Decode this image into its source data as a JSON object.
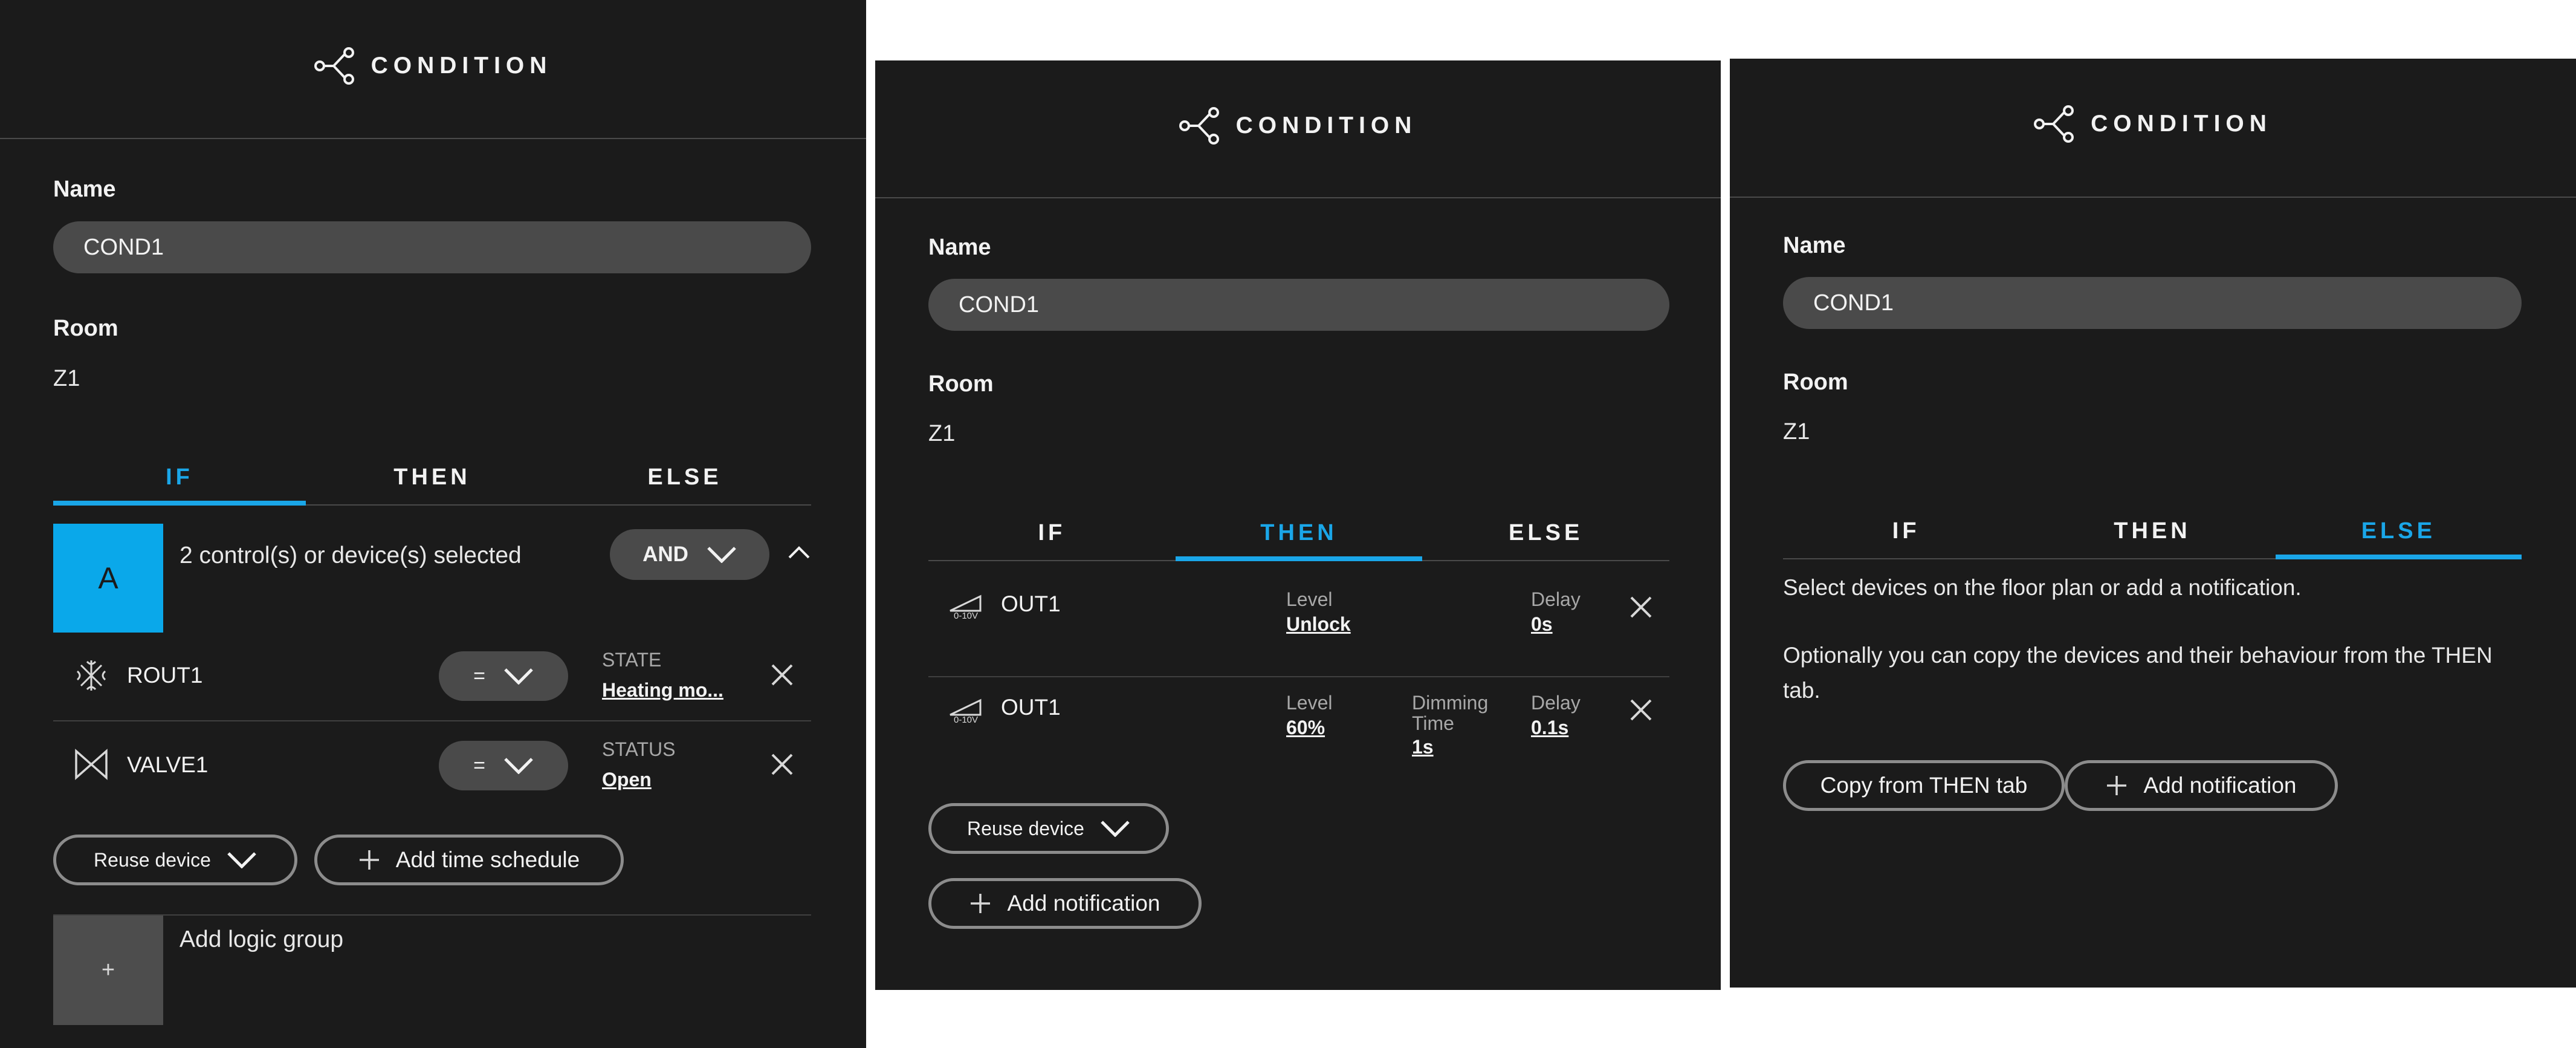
{
  "panels": [
    {
      "title": "CONDITION",
      "name_label": "Name",
      "name_value": "COND1",
      "room_label": "Room",
      "room_value": "Z1",
      "tabs": [
        "IF",
        "THEN",
        "ELSE"
      ],
      "active_tab": "IF",
      "group": {
        "letter": "A",
        "summary": "2 control(s) or device(s) selected",
        "operator": "AND",
        "rows": [
          {
            "name": "ROUT1",
            "icon": "heating-icon",
            "operator": "=",
            "prop_label": "STATE",
            "prop_value": "Heating mo..."
          },
          {
            "name": "VALVE1",
            "icon": "valve-icon",
            "operator": "=",
            "prop_label": "STATUS",
            "prop_value": "Open"
          }
        ]
      },
      "reuse_label": "Reuse device",
      "add_time_schedule_label": "Add time schedule",
      "add_logic_group_label": "Add logic group",
      "add_logic_group_symbol": "+"
    },
    {
      "title": "CONDITION",
      "name_label": "Name",
      "name_value": "COND1",
      "room_label": "Room",
      "room_value": "Z1",
      "tabs": [
        "IF",
        "THEN",
        "ELSE"
      ],
      "active_tab": "THEN",
      "outputs": [
        {
          "name": "OUT1",
          "icon": "dimmer-0-10v-icon",
          "icon_label": "0-10V",
          "level_label": "Level",
          "level_value": "Unlock",
          "delay_label": "Delay",
          "delay_value": "0s"
        },
        {
          "name": "OUT1",
          "icon": "dimmer-0-10v-icon",
          "icon_label": "0-10V",
          "level_label": "Level",
          "level_value": "60%",
          "dimming_label_1": "Dimming",
          "dimming_label_2": "Time",
          "dimming_value": "1s",
          "delay_label": "Delay",
          "delay_value": "0.1s"
        }
      ],
      "reuse_label": "Reuse device",
      "add_notification_label": "Add notification"
    },
    {
      "title": "CONDITION",
      "name_label": "Name",
      "name_value": "COND1",
      "room_label": "Room",
      "room_value": "Z1",
      "tabs": [
        "IF",
        "THEN",
        "ELSE"
      ],
      "active_tab": "ELSE",
      "message_1": "Select devices on the floor plan or add a notification.",
      "message_2": "Optionally you can copy the devices and their behaviour from the THEN tab.",
      "copy_label": "Copy from THEN tab",
      "add_notification_label": "Add notification"
    }
  ],
  "colors": {
    "panel_bg": "#1b1b1b",
    "accent": "#1aa6e8",
    "field_bg": "#4a4a4a",
    "border": "#8c8c8c",
    "logic_group_bg": "#4d4d4d"
  }
}
